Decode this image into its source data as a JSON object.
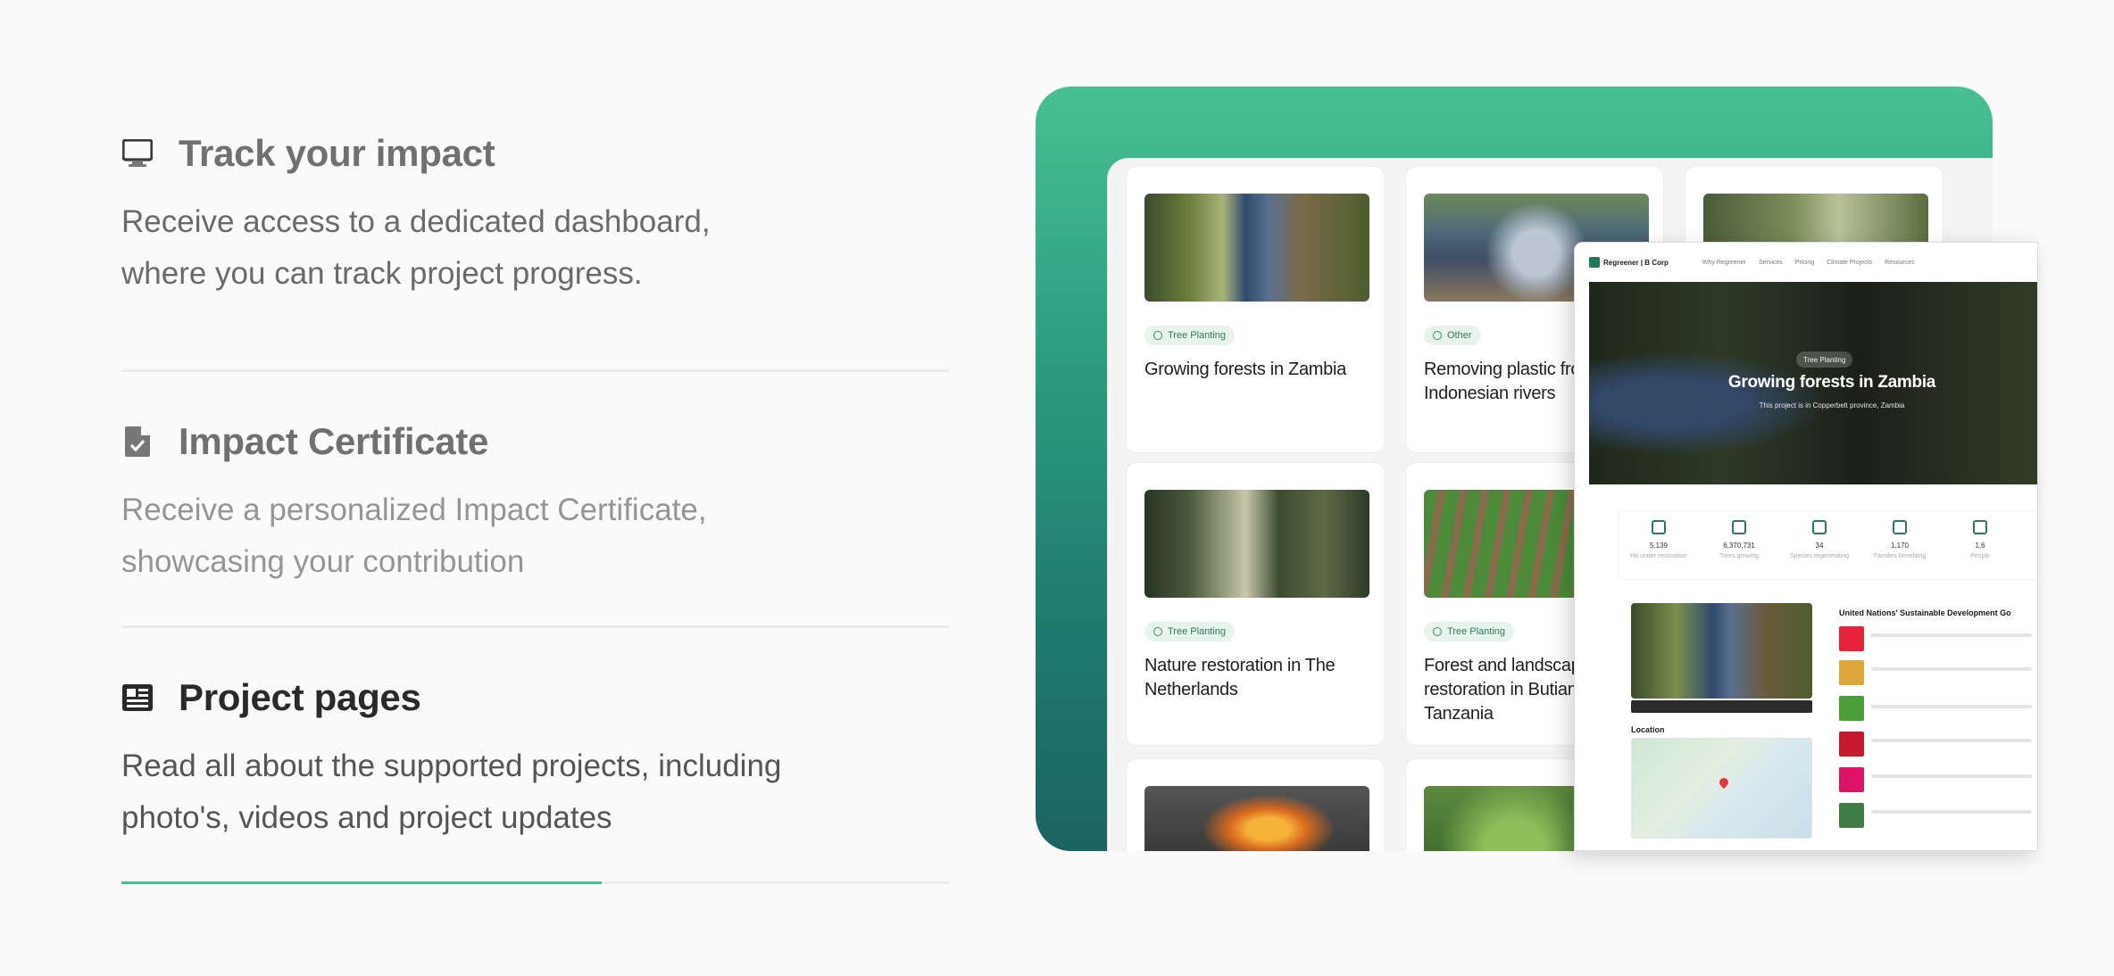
{
  "features": [
    {
      "title": "Track your impact",
      "description": "Receive access to a dedicated dashboard, where you can track project progress.",
      "icon": "monitor-icon",
      "progress": 0
    },
    {
      "title": "Impact Certificate",
      "description": "Receive a personalized Impact Certificate, showcasing your contribution",
      "icon": "certificate-file-icon",
      "progress": 0
    },
    {
      "title": "Project pages",
      "description": "Read all about the supported projects, including photo's, videos and project updates",
      "icon": "newspaper-icon",
      "progress": 0.58
    }
  ],
  "cards": [
    {
      "tag": "Tree Planting",
      "title": "Growing forests in Zambia"
    },
    {
      "tag": "Other",
      "title": "Removing plastic fro Indonesian rivers"
    },
    {
      "tag": "Tree Planting",
      "title": "Nature restoration in The Netherlands"
    },
    {
      "tag": "Tree Planting",
      "title": "Forest and landscap restoration in Butiam Tanzania"
    }
  ],
  "detail": {
    "brand": "Regreener | B Corp",
    "nav": [
      "Why Regreener",
      "Services",
      "Pricing",
      "Climate Projects",
      "Resources"
    ],
    "hero_tag": "Tree Planting",
    "hero_title": "Growing forests in Zambia",
    "hero_sub": "This project is in Copperbelt province, Zambia",
    "stats": [
      {
        "value": "5,139",
        "label": "Ha under restoration"
      },
      {
        "value": "6,370,731",
        "label": "Trees growing"
      },
      {
        "value": "34",
        "label": "Species regenerating"
      },
      {
        "value": "1,170",
        "label": "Families benefiting"
      },
      {
        "value": "1,6",
        "label": "People"
      }
    ],
    "location_label": "Location",
    "sdg_title": "United Nations' Sustainable Development Go"
  },
  "colors": {
    "accent": "#45c08e",
    "gradient_top": "#48c092",
    "gradient_bottom": "#1b6462"
  }
}
